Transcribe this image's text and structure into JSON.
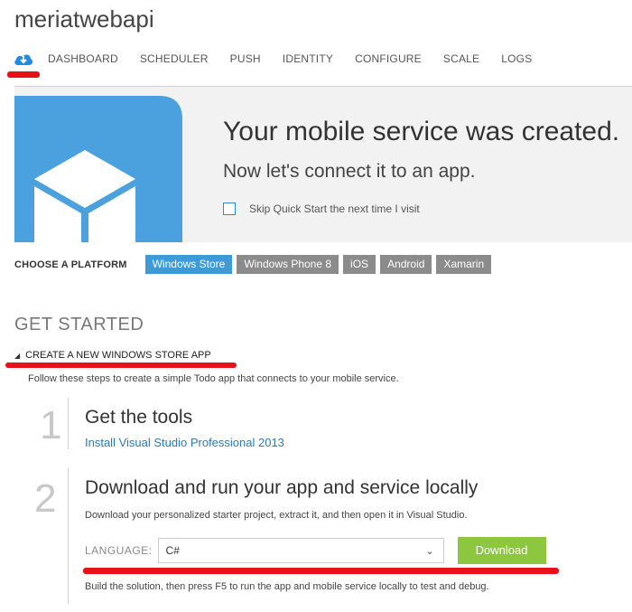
{
  "app": {
    "title": "meriatwebapi"
  },
  "nav": {
    "icon": "quickstart-cloud-icon",
    "tabs": [
      {
        "label": "DASHBOARD"
      },
      {
        "label": "SCHEDULER"
      },
      {
        "label": "PUSH"
      },
      {
        "label": "IDENTITY"
      },
      {
        "label": "CONFIGURE"
      },
      {
        "label": "SCALE"
      },
      {
        "label": "LOGS"
      }
    ]
  },
  "banner": {
    "heading": "Your mobile service was created.",
    "subheading": "Now let's connect it to an app.",
    "skip_label": "Skip Quick Start the next time I visit",
    "skip_checked": false,
    "illustration": "mobile-device-cube-icon"
  },
  "platform": {
    "label": "CHOOSE A PLATFORM",
    "options": [
      {
        "label": "Windows Store",
        "active": true
      },
      {
        "label": "Windows Phone 8",
        "active": false
      },
      {
        "label": "iOS",
        "active": false
      },
      {
        "label": "Android",
        "active": false
      },
      {
        "label": "Xamarin",
        "active": false
      }
    ]
  },
  "get_started": {
    "heading": "GET STARTED",
    "section_label": "CREATE A NEW WINDOWS STORE APP",
    "intro": "Follow these steps to create a simple Todo app that connects to your mobile service."
  },
  "steps": [
    {
      "number": "1",
      "title": "Get the tools",
      "link": "Install Visual Studio Professional 2013"
    },
    {
      "number": "2",
      "title": "Download and run your app and service locally",
      "description": "Download your personalized starter project, extract it, and then open it in Visual Studio.",
      "language_label": "LANGUAGE:",
      "language_value": "C#",
      "download_label": "Download",
      "footer": "Build the solution, then press F5 to run the app and mobile service locally to test and debug."
    }
  ],
  "colors": {
    "accent_blue": "#3d9bd8",
    "download_green": "#8dc63f",
    "annotation_red": "#e8111b",
    "link_blue": "#2a7ab8"
  }
}
